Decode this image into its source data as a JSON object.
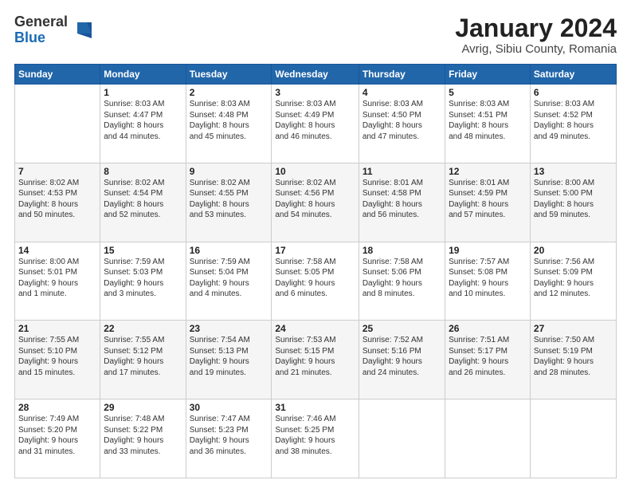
{
  "logo": {
    "general": "General",
    "blue": "Blue"
  },
  "title": "January 2024",
  "subtitle": "Avrig, Sibiu County, Romania",
  "days_header": [
    "Sunday",
    "Monday",
    "Tuesday",
    "Wednesday",
    "Thursday",
    "Friday",
    "Saturday"
  ],
  "weeks": [
    [
      {
        "day": "",
        "info": ""
      },
      {
        "day": "1",
        "info": "Sunrise: 8:03 AM\nSunset: 4:47 PM\nDaylight: 8 hours\nand 44 minutes."
      },
      {
        "day": "2",
        "info": "Sunrise: 8:03 AM\nSunset: 4:48 PM\nDaylight: 8 hours\nand 45 minutes."
      },
      {
        "day": "3",
        "info": "Sunrise: 8:03 AM\nSunset: 4:49 PM\nDaylight: 8 hours\nand 46 minutes."
      },
      {
        "day": "4",
        "info": "Sunrise: 8:03 AM\nSunset: 4:50 PM\nDaylight: 8 hours\nand 47 minutes."
      },
      {
        "day": "5",
        "info": "Sunrise: 8:03 AM\nSunset: 4:51 PM\nDaylight: 8 hours\nand 48 minutes."
      },
      {
        "day": "6",
        "info": "Sunrise: 8:03 AM\nSunset: 4:52 PM\nDaylight: 8 hours\nand 49 minutes."
      }
    ],
    [
      {
        "day": "7",
        "info": "Sunrise: 8:02 AM\nSunset: 4:53 PM\nDaylight: 8 hours\nand 50 minutes."
      },
      {
        "day": "8",
        "info": "Sunrise: 8:02 AM\nSunset: 4:54 PM\nDaylight: 8 hours\nand 52 minutes."
      },
      {
        "day": "9",
        "info": "Sunrise: 8:02 AM\nSunset: 4:55 PM\nDaylight: 8 hours\nand 53 minutes."
      },
      {
        "day": "10",
        "info": "Sunrise: 8:02 AM\nSunset: 4:56 PM\nDaylight: 8 hours\nand 54 minutes."
      },
      {
        "day": "11",
        "info": "Sunrise: 8:01 AM\nSunset: 4:58 PM\nDaylight: 8 hours\nand 56 minutes."
      },
      {
        "day": "12",
        "info": "Sunrise: 8:01 AM\nSunset: 4:59 PM\nDaylight: 8 hours\nand 57 minutes."
      },
      {
        "day": "13",
        "info": "Sunrise: 8:00 AM\nSunset: 5:00 PM\nDaylight: 8 hours\nand 59 minutes."
      }
    ],
    [
      {
        "day": "14",
        "info": "Sunrise: 8:00 AM\nSunset: 5:01 PM\nDaylight: 9 hours\nand 1 minute."
      },
      {
        "day": "15",
        "info": "Sunrise: 7:59 AM\nSunset: 5:03 PM\nDaylight: 9 hours\nand 3 minutes."
      },
      {
        "day": "16",
        "info": "Sunrise: 7:59 AM\nSunset: 5:04 PM\nDaylight: 9 hours\nand 4 minutes."
      },
      {
        "day": "17",
        "info": "Sunrise: 7:58 AM\nSunset: 5:05 PM\nDaylight: 9 hours\nand 6 minutes."
      },
      {
        "day": "18",
        "info": "Sunrise: 7:58 AM\nSunset: 5:06 PM\nDaylight: 9 hours\nand 8 minutes."
      },
      {
        "day": "19",
        "info": "Sunrise: 7:57 AM\nSunset: 5:08 PM\nDaylight: 9 hours\nand 10 minutes."
      },
      {
        "day": "20",
        "info": "Sunrise: 7:56 AM\nSunset: 5:09 PM\nDaylight: 9 hours\nand 12 minutes."
      }
    ],
    [
      {
        "day": "21",
        "info": "Sunrise: 7:55 AM\nSunset: 5:10 PM\nDaylight: 9 hours\nand 15 minutes."
      },
      {
        "day": "22",
        "info": "Sunrise: 7:55 AM\nSunset: 5:12 PM\nDaylight: 9 hours\nand 17 minutes."
      },
      {
        "day": "23",
        "info": "Sunrise: 7:54 AM\nSunset: 5:13 PM\nDaylight: 9 hours\nand 19 minutes."
      },
      {
        "day": "24",
        "info": "Sunrise: 7:53 AM\nSunset: 5:15 PM\nDaylight: 9 hours\nand 21 minutes."
      },
      {
        "day": "25",
        "info": "Sunrise: 7:52 AM\nSunset: 5:16 PM\nDaylight: 9 hours\nand 24 minutes."
      },
      {
        "day": "26",
        "info": "Sunrise: 7:51 AM\nSunset: 5:17 PM\nDaylight: 9 hours\nand 26 minutes."
      },
      {
        "day": "27",
        "info": "Sunrise: 7:50 AM\nSunset: 5:19 PM\nDaylight: 9 hours\nand 28 minutes."
      }
    ],
    [
      {
        "day": "28",
        "info": "Sunrise: 7:49 AM\nSunset: 5:20 PM\nDaylight: 9 hours\nand 31 minutes."
      },
      {
        "day": "29",
        "info": "Sunrise: 7:48 AM\nSunset: 5:22 PM\nDaylight: 9 hours\nand 33 minutes."
      },
      {
        "day": "30",
        "info": "Sunrise: 7:47 AM\nSunset: 5:23 PM\nDaylight: 9 hours\nand 36 minutes."
      },
      {
        "day": "31",
        "info": "Sunrise: 7:46 AM\nSunset: 5:25 PM\nDaylight: 9 hours\nand 38 minutes."
      },
      {
        "day": "",
        "info": ""
      },
      {
        "day": "",
        "info": ""
      },
      {
        "day": "",
        "info": ""
      }
    ]
  ]
}
